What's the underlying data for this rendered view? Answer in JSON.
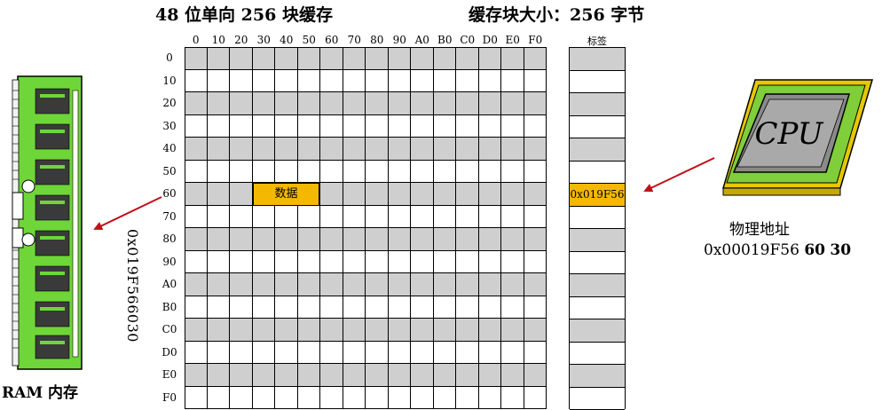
{
  "title_left": "48 位单向 256 块缓存",
  "title_right": "缓存块大小：256 字节",
  "columns": [
    "0",
    "10",
    "20",
    "30",
    "40",
    "50",
    "60",
    "70",
    "80",
    "90",
    "A0",
    "B0",
    "C0",
    "D0",
    "E0",
    "F0"
  ],
  "rows": [
    "0",
    "10",
    "20",
    "30",
    "40",
    "50",
    "60",
    "70",
    "80",
    "90",
    "A0",
    "B0",
    "C0",
    "D0",
    "E0",
    "F0"
  ],
  "tag_header": "标签",
  "data_label": "数据",
  "tag_value": "0x019F56",
  "highlight": {
    "row": "60",
    "col_start": "30",
    "col_end": "50"
  },
  "memory_address_vertical": "0x019F566030",
  "ram_label": "RAM 内存",
  "cpu": {
    "chip_label": "CPU",
    "physical_address_label": "物理地址",
    "address_prefix": "0x00019F56",
    "address_index": "60",
    "address_offset": "30"
  },
  "colors": {
    "gray_row": "#cfcfcf",
    "highlight": "#f5b800",
    "arrow": "#c0101b",
    "board": "#6fd63a"
  },
  "icons": [
    "ram-module-icon",
    "cpu-chip-icon"
  ]
}
